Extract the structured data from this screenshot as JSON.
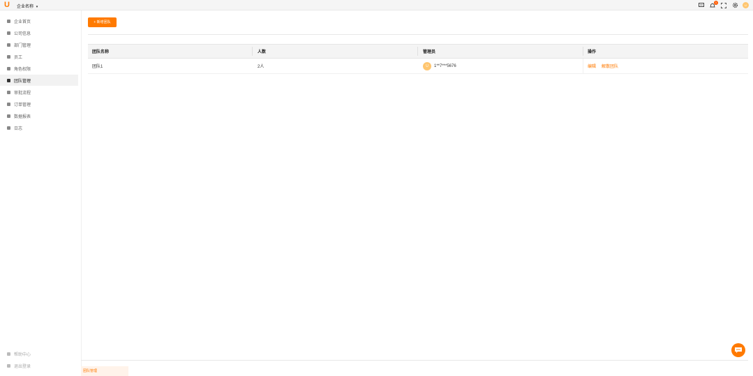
{
  "header": {
    "logo_text": "U",
    "company_name": "企业名称",
    "caret": "▾",
    "notification_count": "1",
    "user_avatar_text": "U",
    "accent_color": "#ff7a00"
  },
  "sidebar": {
    "items": [
      {
        "label": "企业首页",
        "icon": "folder-icon"
      },
      {
        "label": "公司信息",
        "icon": "org-icon"
      },
      {
        "label": "部门管理",
        "icon": "building-icon"
      },
      {
        "label": "员工",
        "icon": "user-icon"
      },
      {
        "label": "角色权限",
        "icon": "people-icon"
      },
      {
        "label": "团队管理",
        "icon": "team-icon"
      },
      {
        "label": "审批流程",
        "icon": "settings-icon"
      },
      {
        "label": "订单管理",
        "icon": "doc-icon"
      },
      {
        "label": "数据报表",
        "icon": "list-icon"
      },
      {
        "label": "日志",
        "icon": "log-icon"
      }
    ],
    "active_index": 5,
    "bottom_items": [
      {
        "label": "帮助中心",
        "icon": "help-icon"
      },
      {
        "label": "退出登录",
        "icon": "logout-icon"
      }
    ]
  },
  "toolbar": {
    "add_label": "+ 新增团队"
  },
  "table": {
    "columns": [
      "团队名称",
      "人数",
      "管理员",
      "操作"
    ],
    "rows": [
      {
        "name": "团队1",
        "count": "2人",
        "manager_initial": "U",
        "manager": "1**7***5676",
        "action_edit": "编辑",
        "action_delete": "解散团队"
      }
    ]
  },
  "footer": {
    "tab_label": "团队管理"
  }
}
